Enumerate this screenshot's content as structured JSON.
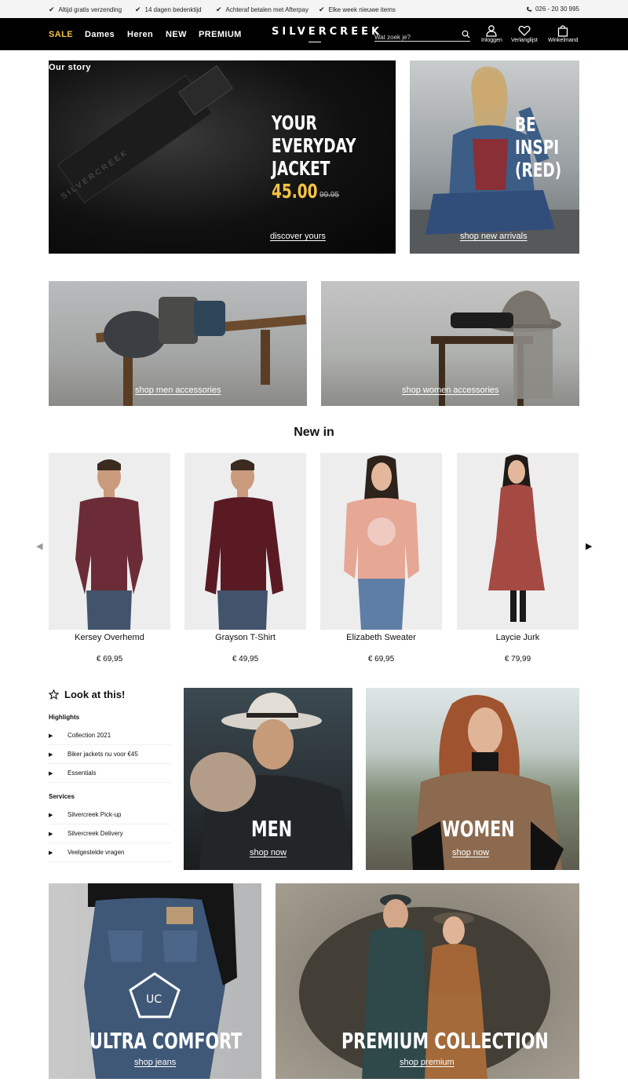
{
  "usp": [
    {
      "label": "Altijd gratis verzending"
    },
    {
      "label": "14 dagen bedenktijd"
    },
    {
      "label": "Achteraf betalen met Afterpay"
    },
    {
      "label": "Elke week nieuwe items"
    }
  ],
  "phone": "026 - 20 30 995",
  "nav": {
    "links": [
      "SALE",
      "Dames",
      "Heren",
      "NEW",
      "PREMIUM"
    ],
    "logo": "SILVERCREEK",
    "search_placeholder": "Wat zoek je?",
    "actions": [
      "Inloggen",
      "Verlanglijst",
      "Winkelmand"
    ]
  },
  "hero": {
    "story_label": "Our story",
    "main": {
      "line1": "YOUR",
      "line2": "EVERYDAY",
      "line3": "JACKET",
      "price": "45.00",
      "old_price": "99.95",
      "cta": "discover yours",
      "brand_on_zip": "SILVERCREEK"
    },
    "side": {
      "line1": "BE",
      "line2": "INSPI",
      "line3": "(RED)",
      "cta": "shop new arrivals"
    }
  },
  "accessories": [
    {
      "cta": "shop men accessories"
    },
    {
      "cta": "shop women accessories"
    }
  ],
  "new_in": {
    "title": "New in",
    "products": [
      {
        "name": "Kersey Overhemd",
        "price": "€ 69,95"
      },
      {
        "name": "Grayson T-Shirt",
        "price": "€ 49,95"
      },
      {
        "name": "Elizabeth Sweater",
        "price": "€ 69,95"
      },
      {
        "name": "Laycie Jurk",
        "price": "€ 79,99"
      }
    ]
  },
  "look": {
    "title": "Look at this!",
    "highlights_title": "Highlights",
    "highlights": [
      "Collection 2021",
      "Biker jackets nu voor €45",
      "Essentials"
    ],
    "services_title": "Services",
    "services": [
      "Silvercreek Pick-up",
      "Silvercreek Delivery",
      "Veelgestelde vragen"
    ]
  },
  "categories": {
    "men": {
      "title": "MEN",
      "cta": "shop now"
    },
    "women": {
      "title": "WOMEN",
      "cta": "shop now"
    },
    "jeans": {
      "title": "ULTRA COMFORT",
      "badge": "UC",
      "cta": "shop jeans"
    },
    "premium": {
      "title": "PREMIUM COLLECTION",
      "cta": "shop premium"
    }
  },
  "colors": {
    "accent": "#f5c242",
    "nav_bg": "#000000"
  }
}
